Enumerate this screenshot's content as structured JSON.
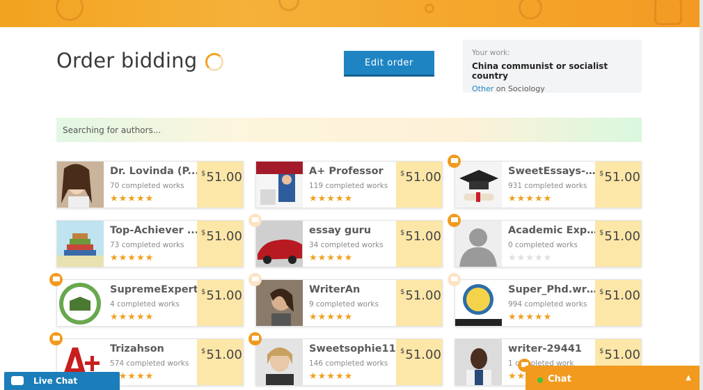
{
  "header": {
    "title": "Order bidding",
    "edit_button": "Edit order"
  },
  "work": {
    "label": "Your work:",
    "title": "China communist or socialist country",
    "type_link": "Other",
    "subject_prefix": "on",
    "subject": "Sociology"
  },
  "search": {
    "status": "Searching for authors..."
  },
  "authors": [
    {
      "name": "Dr. Lovinda (P...",
      "works": "70 completed works",
      "price": "51.00",
      "currency": "$",
      "stars": "★★★★★",
      "has_message": false
    },
    {
      "name": "A+ Professor",
      "works": "119 completed works",
      "price": "51.00",
      "currency": "$",
      "stars": "★★★★★",
      "has_message": false
    },
    {
      "name": "SweetEssays-2...",
      "works": "931 completed works",
      "price": "51.00",
      "currency": "$",
      "stars": "★★★★★",
      "has_message": true
    },
    {
      "name": "Top-Achiever ...",
      "works": "73 completed works",
      "price": "51.00",
      "currency": "$",
      "stars": "★★★★★",
      "has_message": false
    },
    {
      "name": "essay guru",
      "works": "34 completed works",
      "price": "51.00",
      "currency": "$",
      "stars": "★★★★★",
      "has_message": true
    },
    {
      "name": "Academic Exp...",
      "works": "0 completed works",
      "price": "51.00",
      "currency": "$",
      "stars": "★★★★★",
      "has_message": true
    },
    {
      "name": "SupremeExpert",
      "works": "4 completed works",
      "price": "51.00",
      "currency": "$",
      "stars": "★★★★★",
      "has_message": true
    },
    {
      "name": "WriterAn",
      "works": "9 completed works",
      "price": "51.00",
      "currency": "$",
      "stars": "★★★★★",
      "has_message": true
    },
    {
      "name": "Super_Phd.wri...",
      "works": "994 completed works",
      "price": "51.00",
      "currency": "$",
      "stars": "★★★★★",
      "has_message": true
    },
    {
      "name": "Trizahson",
      "works": "574 completed works",
      "price": "51.00",
      "currency": "$",
      "stars": "★★★★★",
      "has_message": true
    },
    {
      "name": "Sweetsophie11",
      "works": "146 completed works",
      "price": "51.00",
      "currency": "$",
      "stars": "★★★★★",
      "has_message": true
    },
    {
      "name": "writer-29441",
      "works": "1 completed work",
      "price": "51.00",
      "currency": "$",
      "stars": "★★★★★",
      "has_message": true
    }
  ],
  "widgets": {
    "live_chat": "Live Chat",
    "chat": "Chat",
    "chat_arrow": "▲"
  },
  "colors": {
    "accent": "#f29a1e",
    "button": "#1e85c2",
    "price_bg": "#fde7a8",
    "star": "#f0a020"
  }
}
